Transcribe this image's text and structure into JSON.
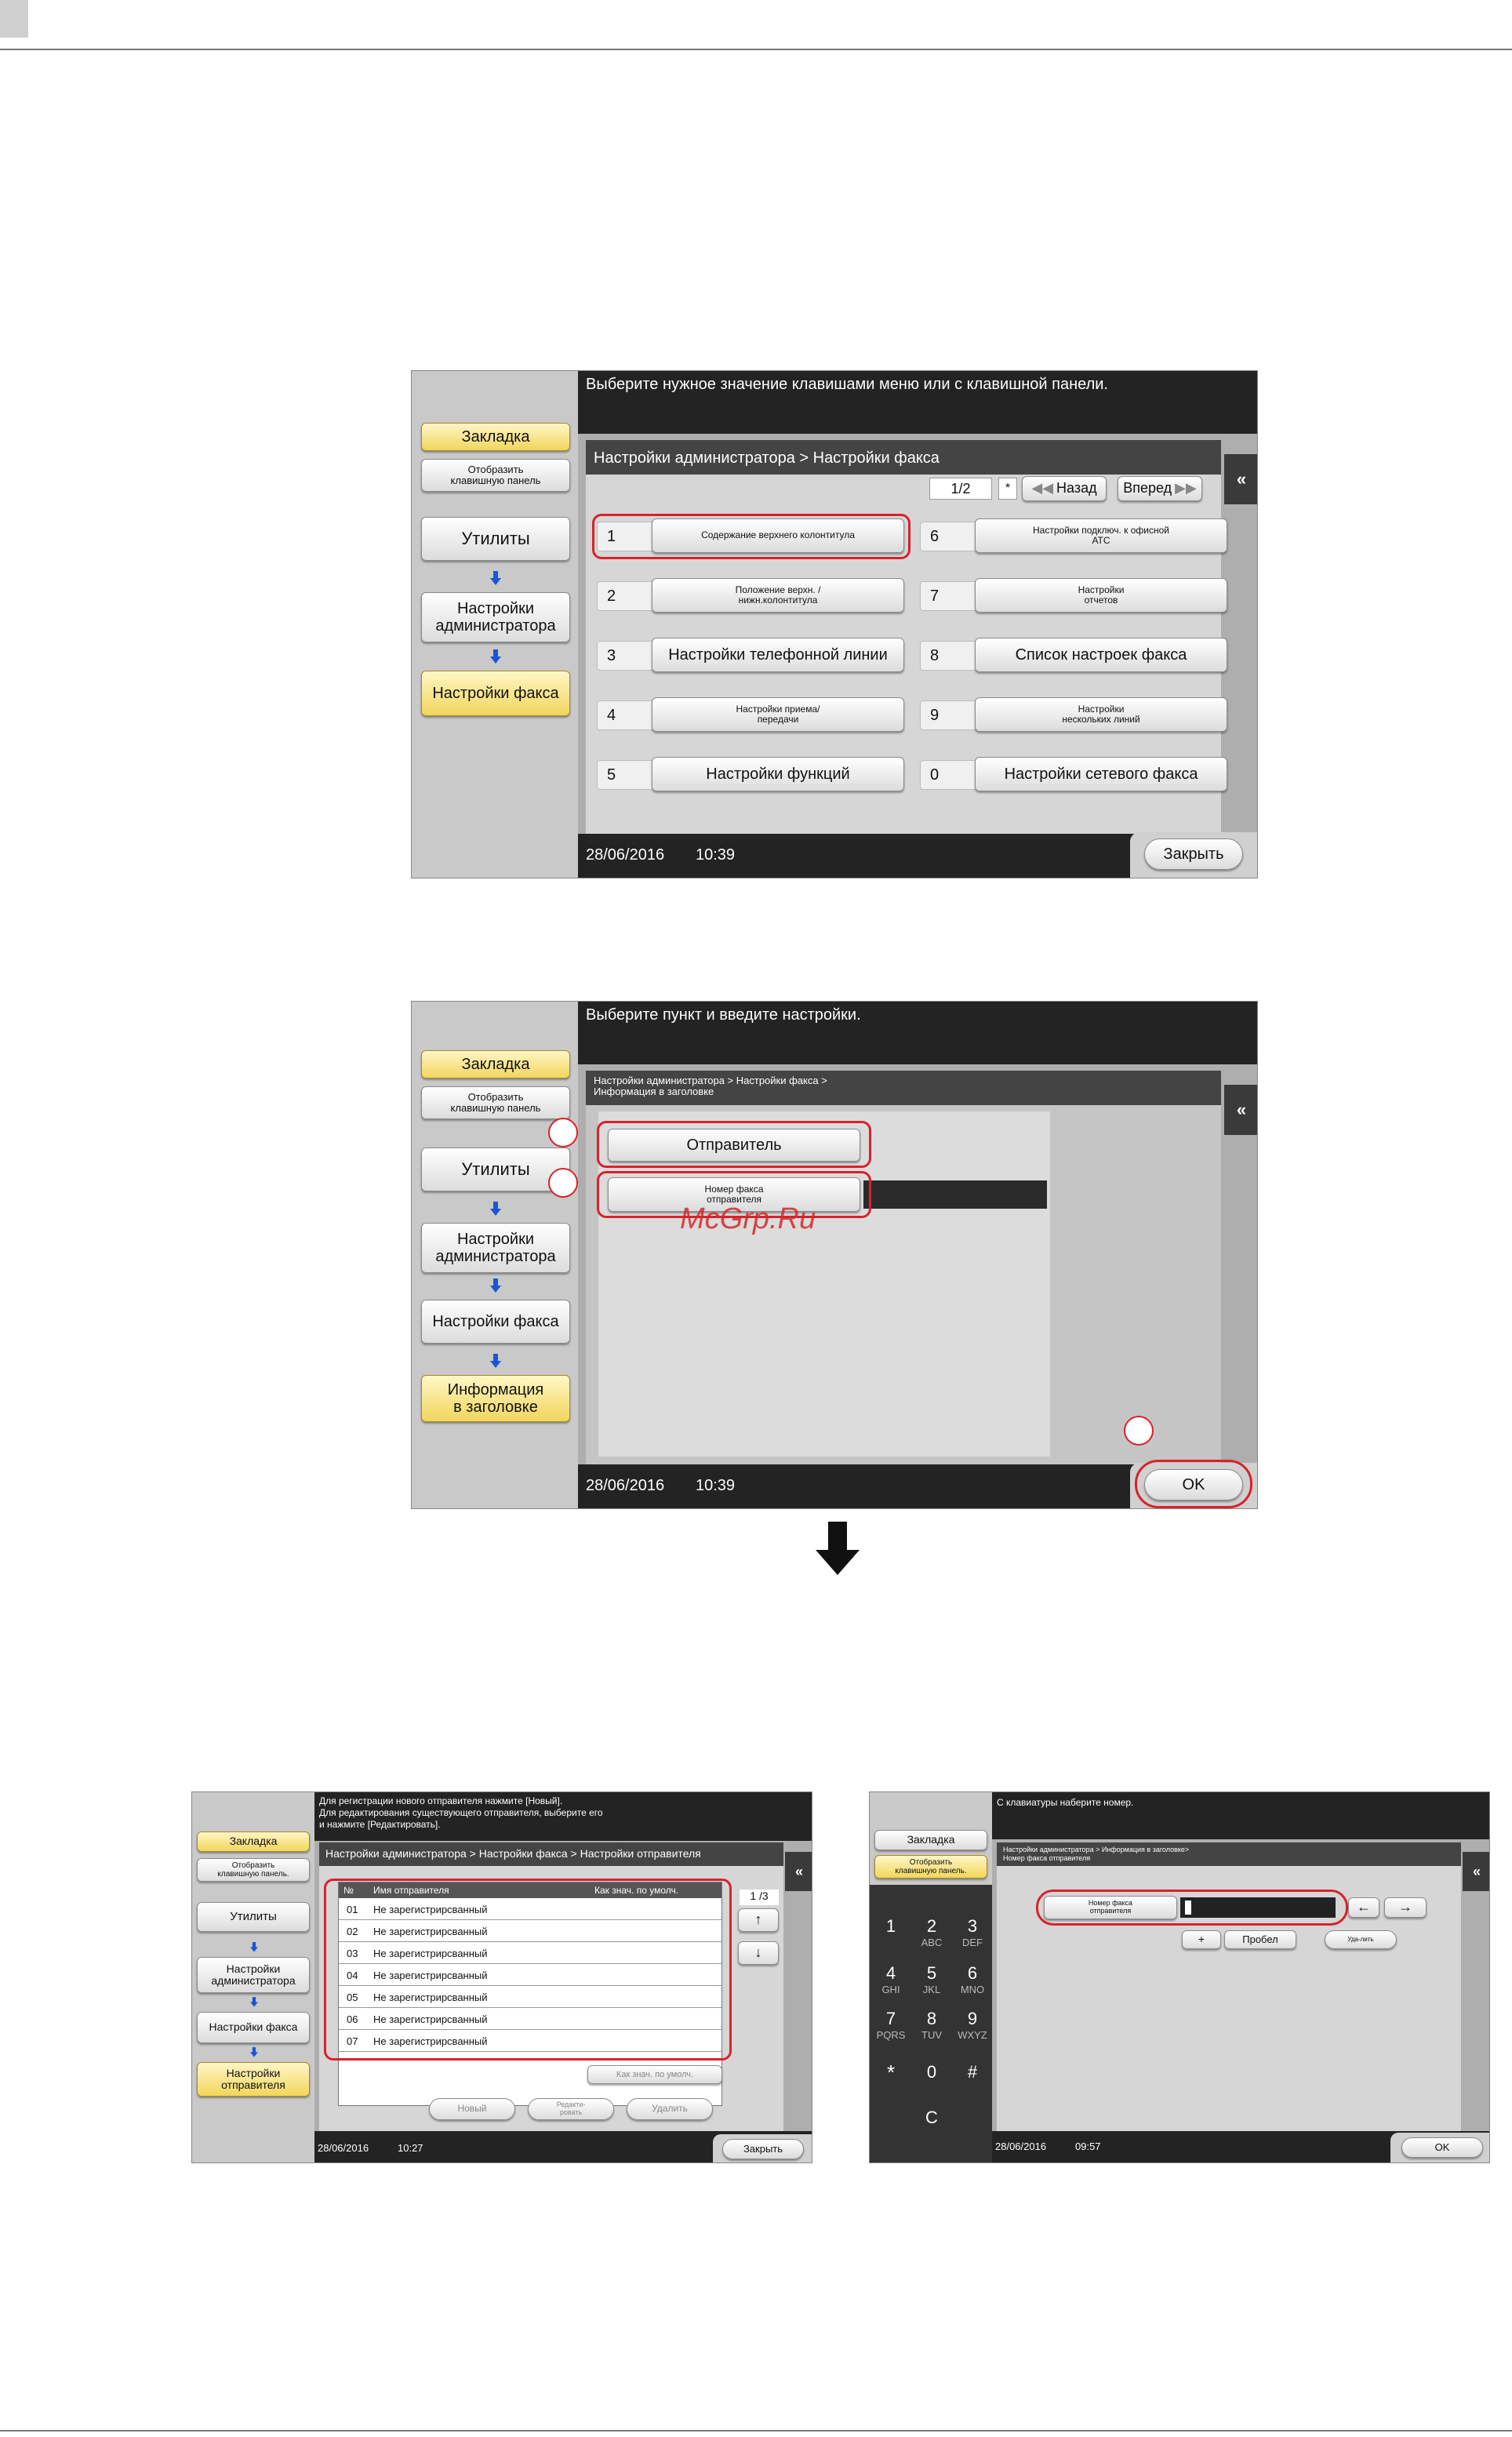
{
  "screen1": {
    "instruction": "Выберите нужное значение клавишами меню или с клавишной панели.",
    "sidebar": {
      "bookmark": "Закладка",
      "keypad": "Отобразить клавишную панель",
      "utilities": "Утилиты",
      "admin": "Настройки администратора",
      "fax": "Настройки факса"
    },
    "breadcrumb": "Настройки администратора  > Настройки факса",
    "page": "1/2",
    "star": "*",
    "back": "Назад",
    "forward": "Вперед",
    "items": [
      {
        "num": "1",
        "label": "Содержание верхнего колонтитула"
      },
      {
        "num": "2",
        "label": "Положение верхн. /нижн.колонтитула"
      },
      {
        "num": "3",
        "label": "Настройки телефонной линии"
      },
      {
        "num": "4",
        "label": "Настройки приема/передачи"
      },
      {
        "num": "5",
        "label": "Настройки функций"
      },
      {
        "num": "6",
        "label": "Настройки подключ. к офисной АТС"
      },
      {
        "num": "7",
        "label": "Настройки отчетов"
      },
      {
        "num": "8",
        "label": "Список настроек факса"
      },
      {
        "num": "9",
        "label": "Настройки нескольких линий"
      },
      {
        "num": "0",
        "label": "Настройки сетевого факса"
      }
    ],
    "date": "28/06/2016",
    "time": "10:39",
    "close": "Закрыть"
  },
  "screen2": {
    "instruction": "Выберите пункт и введите настройки.",
    "sidebar": {
      "bookmark": "Закладка",
      "keypad": "Отобразить клавишную панель",
      "utilities": "Утилиты",
      "admin": "Настройки администратора",
      "fax": "Настройки факса",
      "header_info": "Информация в заголовке"
    },
    "breadcrumb_line1": "Настройки администратора  > Настройки факса  >",
    "breadcrumb_line2": "Информация в заголовке",
    "sender": "Отправитель",
    "fax_number": "Номер факса отправителя",
    "watermark": "McGrp.Ru",
    "date": "28/06/2016",
    "time": "10:39",
    "ok": "OK"
  },
  "screen3": {
    "instruction_lines": [
      "Для регистрации нового отправителя нажмите [Новый].",
      "Для редактирования существующего отправителя, выберите его",
      "и нажмите [Редактировать]."
    ],
    "sidebar": {
      "bookmark": "Закладка",
      "keypad": "Отобразить клавишную панель.",
      "utilities": "Утилиты",
      "admin": "Настройки администратора",
      "fax": "Настройки факса",
      "sender_settings": "Настройки отправителя"
    },
    "breadcrumb": "Настройки администратора > Настройки факса > Настройки отправителя",
    "table_headers": [
      "№",
      "Имя отправителя",
      "Как знач. по умолч."
    ],
    "rows": [
      {
        "num": "01",
        "name": "Не зарегистрирсванный"
      },
      {
        "num": "02",
        "name": "Не зарегистрирсванный"
      },
      {
        "num": "03",
        "name": "Не зарегистрирсванный"
      },
      {
        "num": "04",
        "name": "Не зарегистрирсванный"
      },
      {
        "num": "05",
        "name": "Не зарегистрирсванный"
      },
      {
        "num": "06",
        "name": "Не зарегистрирсванный"
      },
      {
        "num": "07",
        "name": "Не зарегистрирсванный"
      }
    ],
    "page": "1 /3",
    "default_btn": "Как знач. по умолч.",
    "new": "Новый",
    "edit": "Редакти-ровать",
    "delete": "Удалить",
    "date": "28/06/2016",
    "time": "10:27",
    "close": "Закрыть"
  },
  "screen4": {
    "instruction": "С клавиатуры наберите номер.",
    "sidebar": {
      "bookmark": "Закладка",
      "keypad": "Отобразить клавишную панель."
    },
    "breadcrumb_line1": "Настройки администратора > Информация в заголовке>",
    "breadcrumb_line2": "Номер факса отправителя",
    "field_label": "Номер факса отправителя",
    "plus": "+",
    "space": "Пробел",
    "delete": "Уда-лить",
    "keys": [
      {
        "d": "1",
        "l": ""
      },
      {
        "d": "2",
        "l": "ABC"
      },
      {
        "d": "3",
        "l": "DEF"
      },
      {
        "d": "4",
        "l": "GHI"
      },
      {
        "d": "5",
        "l": "JKL"
      },
      {
        "d": "6",
        "l": "MNO"
      },
      {
        "d": "7",
        "l": "PQRS"
      },
      {
        "d": "8",
        "l": "TUV"
      },
      {
        "d": "9",
        "l": "WXYZ"
      },
      {
        "d": "*",
        "l": ""
      },
      {
        "d": "0",
        "l": ""
      },
      {
        "d": "#",
        "l": ""
      },
      {
        "d": "C",
        "l": ""
      }
    ],
    "date": "28/06/2016",
    "time": "09:57",
    "ok": "OK"
  },
  "icons": {
    "double_left": "double-chevron-left-icon",
    "down_arrow": "down-arrow-icon",
    "up_arrow": "up-arrow-icon",
    "left_arrow": "left-arrow-icon",
    "right_arrow": "right-arrow-icon"
  },
  "colors": {
    "highlight_red": "#d9222a",
    "selected_yellow": "#f2d65c",
    "nav_arrow_blue": "#1a55d6"
  }
}
